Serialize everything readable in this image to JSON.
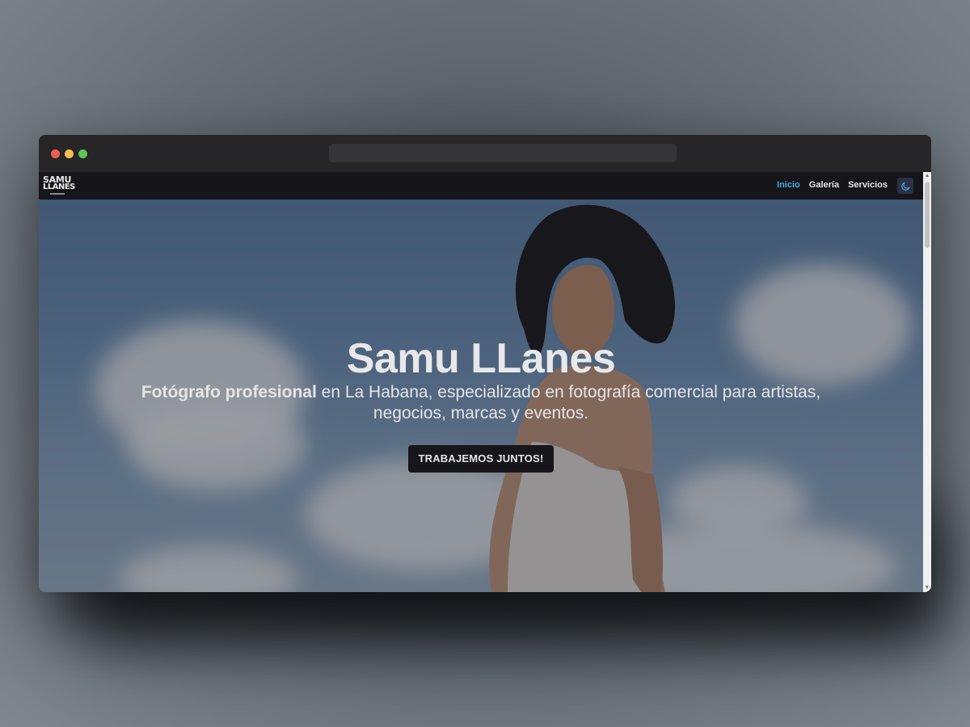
{
  "brand": {
    "logo_line1": "SAMU",
    "logo_line2": "LLANES"
  },
  "nav": {
    "items": [
      {
        "label": "Inicio",
        "active": true
      },
      {
        "label": "Galería",
        "active": false
      },
      {
        "label": "Servicios",
        "active": false
      }
    ],
    "theme_toggle_icon": "moon-icon"
  },
  "hero": {
    "title": "Samu LLanes",
    "subtitle_bold": "Fotógrafo profesional",
    "subtitle_rest": " en La Habana, especializado en fotografía comercial para artistas, negocios, marcas y eventos.",
    "cta_label": "TRABAJEMOS JUNTOS!"
  },
  "colors": {
    "accent": "#4aa8e8",
    "navbar_bg": "#16161a",
    "button_bg": "#17171b",
    "window_chrome": "#262628",
    "traffic_red": "#ed5f57",
    "traffic_yellow": "#f4bd4f",
    "traffic_green": "#5fc55a"
  }
}
